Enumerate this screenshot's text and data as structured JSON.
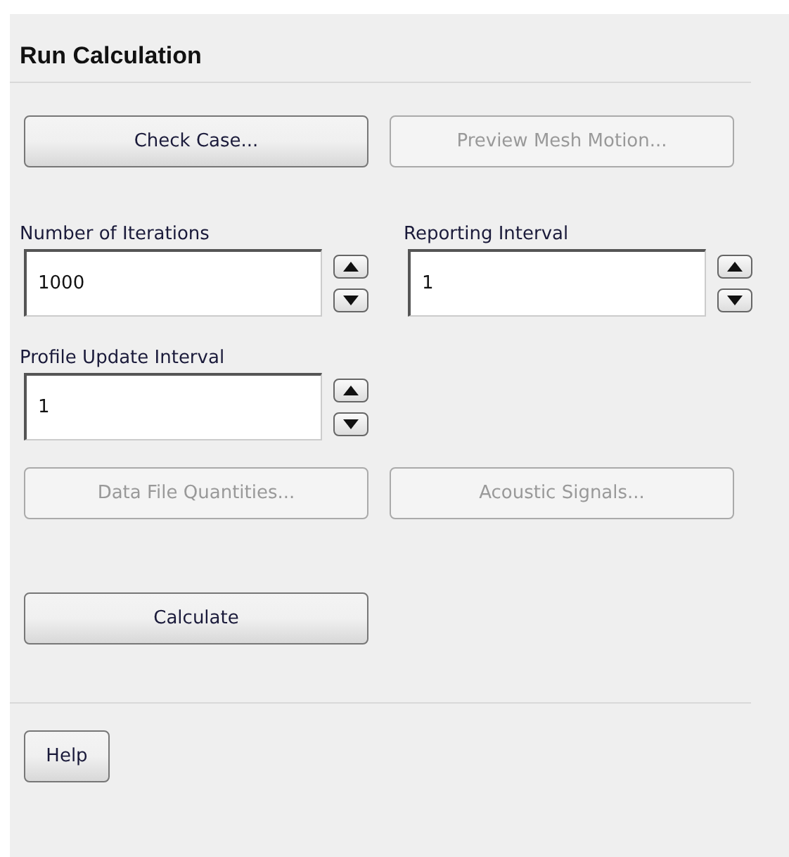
{
  "panel": {
    "title": "Run Calculation"
  },
  "top_buttons": [
    {
      "label": "Check Case...",
      "disabled": false
    },
    {
      "label": "Preview Mesh Motion...",
      "disabled": true
    }
  ],
  "fields": [
    {
      "label": "Number of Iterations",
      "value": "1000"
    },
    {
      "label": "Reporting Interval",
      "value": "1"
    },
    {
      "label": "Profile Update Interval",
      "value": "1"
    }
  ],
  "lower_buttons": [
    {
      "label": "Data File Quantities...",
      "disabled": true
    },
    {
      "label": "Acoustic Signals...",
      "disabled": true
    }
  ],
  "calculate_button": {
    "label": "Calculate",
    "disabled": false
  },
  "help_button": {
    "label": "Help",
    "disabled": false
  }
}
